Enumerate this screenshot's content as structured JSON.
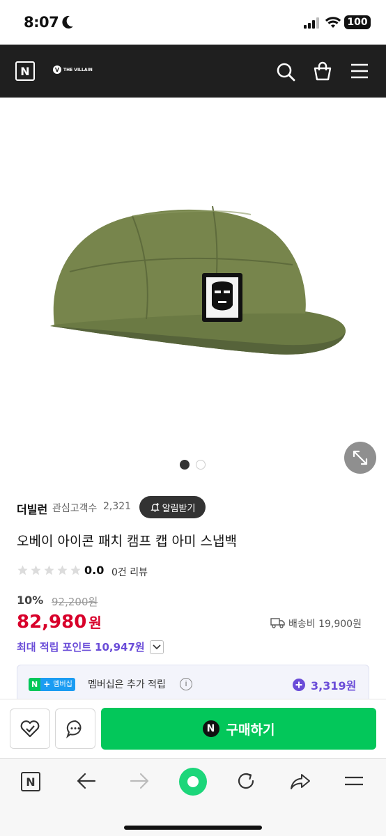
{
  "status_bar": {
    "time": "8:07",
    "battery": "100"
  },
  "header": {
    "logo": "N",
    "brand": "THE VILLAIN",
    "brand_mark": "V"
  },
  "gallery": {
    "image_alt": "olive green five-panel camp cap with OBEY icon patch",
    "current_page": 1,
    "total_pages": 2
  },
  "store": {
    "name": "더빌런",
    "followers_label": "관심고객수",
    "followers_count": "2,321",
    "follow_button": "알림받기"
  },
  "product": {
    "title": "오베이 아이콘 패치 캠프 캡 아미 스냅백",
    "rating": "0.0",
    "reviews": "0건 리뷰",
    "discount": "10%",
    "original_price": "92,200원",
    "price_number": "82,980",
    "price_unit": "원",
    "shipping": "배송비 19,900원",
    "max_points_label": "최대 적립 포인트",
    "max_points_value": "10,947원"
  },
  "membership": {
    "badge_n": "N",
    "badge_plus": "+",
    "badge_text": "멤버십",
    "description": "멤버십은 추가 적립",
    "points": "3,319원"
  },
  "actions": {
    "buy_label": "구매하기",
    "buy_badge": "N"
  },
  "browser_nav": {
    "home_label": "N"
  },
  "colors": {
    "header_bg": "#1f1f1f",
    "price_red": "#d8002a",
    "points_purple": "#6a4cd8",
    "buy_green": "#03c75a",
    "cap_olive": "#6f7c47"
  },
  "icons": [
    "wifi-icon",
    "signal-icon",
    "moon-icon",
    "search-icon",
    "bag-icon",
    "menu-icon",
    "expand-icon",
    "bell-plus-icon",
    "star-icon",
    "truck-icon",
    "chevron-down-icon",
    "info-icon",
    "plus-circle-icon",
    "heart-check-icon",
    "chat-icon",
    "back-arrow-icon",
    "forward-arrow-icon",
    "record-icon",
    "refresh-icon",
    "share-icon"
  ]
}
